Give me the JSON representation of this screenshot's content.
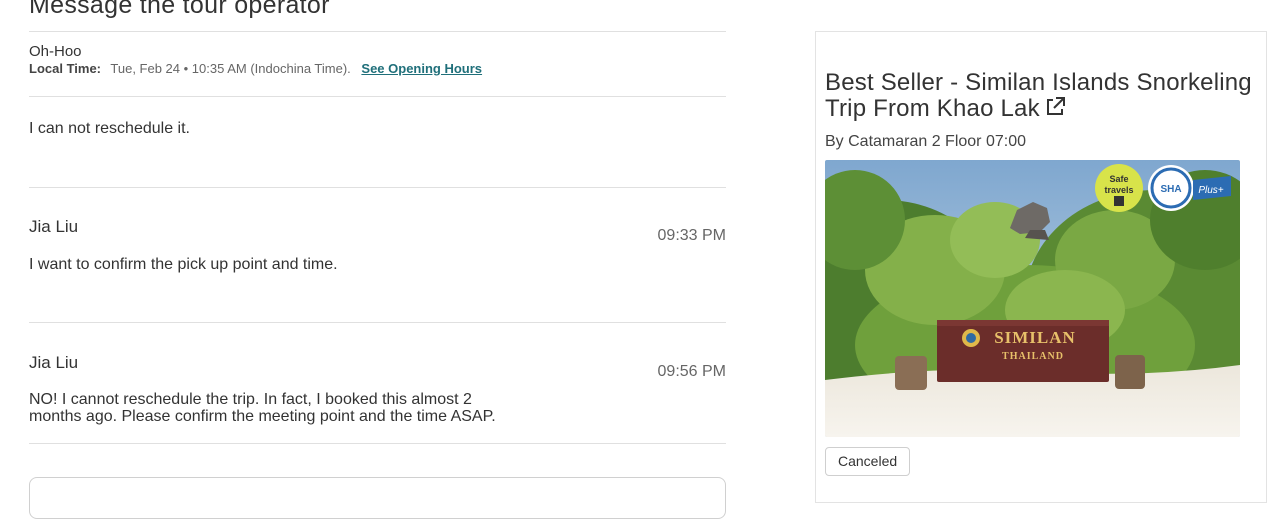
{
  "page_title": "Message the tour operator",
  "operator": {
    "name": "Oh-Hoo",
    "local_time_label": "Local Time:",
    "local_time_value": "Tue, Feb 24 • 10:35 AM (Indochina Time).",
    "opening_hours_link": "See Opening Hours"
  },
  "messages": [
    {
      "sender": "",
      "time": "",
      "text": "I can not reschedule it."
    },
    {
      "sender": "Jia Liu",
      "time": "09:33 PM",
      "text": "I want to confirm the pick up point and time."
    },
    {
      "sender": "Jia Liu",
      "time": "09:56 PM",
      "text": "NO! I cannot reschedule the trip. In fact, I booked this almost 2 months ago. Please confirm the meeting point and the time ASAP."
    }
  ],
  "booking": {
    "title": "Best Seller - Similan Islands Snorkeling Trip From Khao Lak",
    "subtitle": "By Catamaran 2 Floor 07:00",
    "status": "Canceled",
    "sign_text_1": "SIMILAN",
    "sign_text_2": "THAILAND",
    "badge_safe": "Safe travels",
    "badge_sha": "SHA",
    "badge_plus": "Plus+"
  }
}
